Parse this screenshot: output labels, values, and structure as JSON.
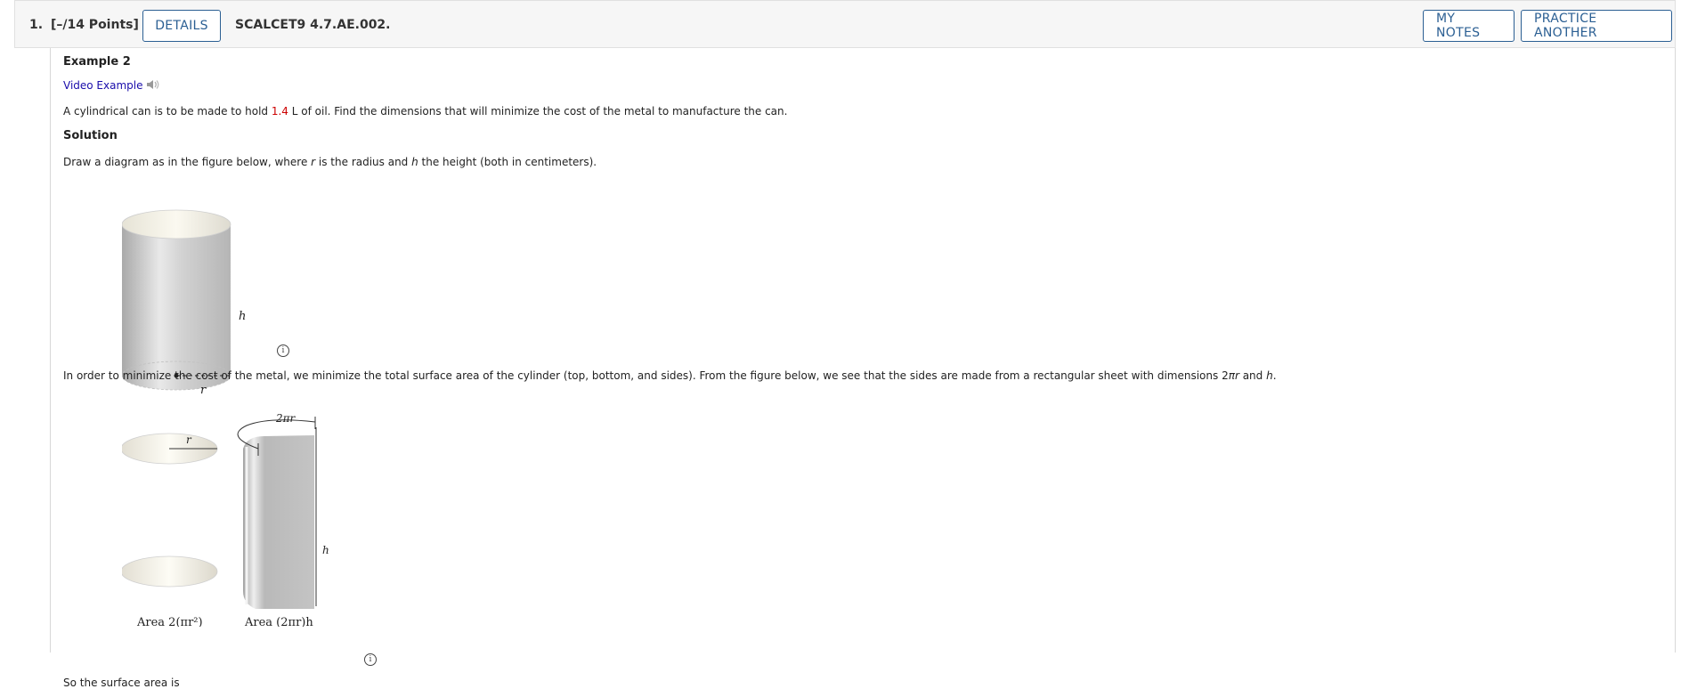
{
  "header": {
    "question_number": "1.",
    "points": "[–/14 Points]",
    "details_label": "DETAILS",
    "problem_code": "SCALCET9 4.7.AE.002.",
    "my_notes_label": "MY NOTES",
    "practice_label": "PRACTICE ANOTHER"
  },
  "content": {
    "example_title": "Example 2",
    "video_link": "Video Example",
    "problem": {
      "pre": "A cylindrical can is to be made to hold ",
      "value": "1.4",
      "post": " L of oil. Find the dimensions that will minimize the cost of the metal to manufacture the can."
    },
    "solution_heading": "Solution",
    "draw_text": {
      "p1": "Draw a diagram as in the figure below, where ",
      "r": "r",
      "p2": " is the radius and ",
      "h": "h",
      "p3": " the height (both in centimeters)."
    },
    "minimize_text": {
      "p1": "In order to minimize the cost of the metal, we minimize the total surface area of the cylinder (top, bottom, and sides). From the figure below, we see that the sides are made from a rectangular sheet with dimensions 2",
      "pi_r": "πr",
      "p2": " and ",
      "h": "h",
      "p3": "."
    },
    "surface_text": "So the surface area is"
  },
  "figure1": {
    "h_label": "h",
    "r_label": "r"
  },
  "figure2": {
    "r_label": "r",
    "two_pi_r_label": "2πr",
    "h_label": "h",
    "area_circles_label": "Area 2(πr²)",
    "area_side_label": "Area (2πr)h"
  },
  "colors": {
    "accent": "#2b5f93",
    "highlight_value": "#cc0000",
    "link": "#1a0dab"
  },
  "icons": [
    "speaker-icon",
    "info-icon"
  ]
}
